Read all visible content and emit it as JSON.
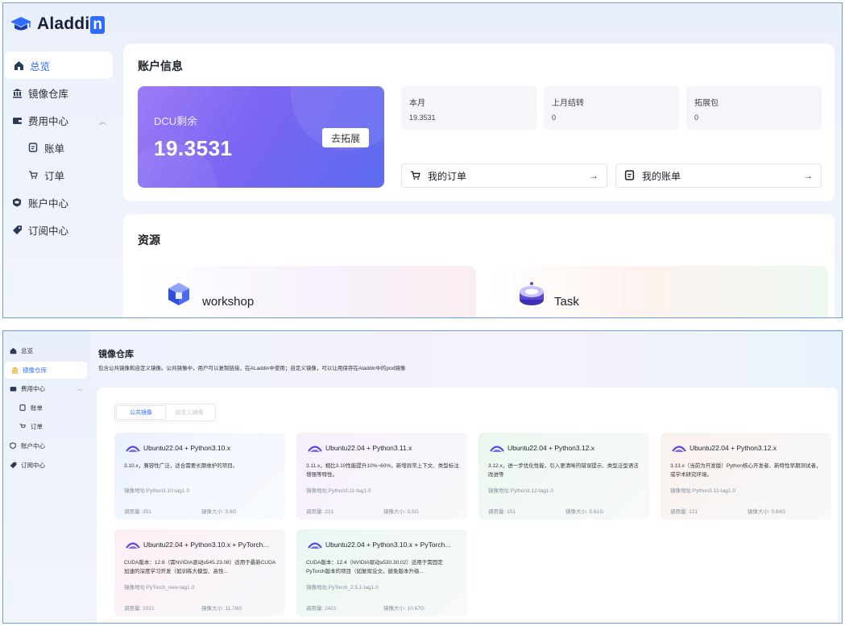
{
  "panel1": {
    "logo": {
      "text": "Aladdi",
      "mark": "n"
    },
    "sidebar": [
      {
        "label": "总览",
        "icon": "home-icon"
      },
      {
        "label": "镜像仓库",
        "icon": "repo-icon"
      },
      {
        "label": "费用中心",
        "icon": "wallet-icon"
      },
      {
        "label": "账单",
        "icon": "bill-icon"
      },
      {
        "label": "订单",
        "icon": "cart-icon"
      },
      {
        "label": "账户中心",
        "icon": "account-icon"
      },
      {
        "label": "订阅中心",
        "icon": "tag-icon"
      }
    ],
    "account": {
      "title": "账户信息",
      "dcu_label": "DCU剩余",
      "dcu_value": "19.3531",
      "expand_button": "去拓展",
      "stats": [
        {
          "label": "本月",
          "value": "19.3531"
        },
        {
          "label": "上月结转",
          "value": "0"
        },
        {
          "label": "拓展包",
          "value": "0"
        }
      ],
      "orders_link": "我的订单",
      "bills_link": "我的账单",
      "arrow": "→"
    },
    "resources": {
      "title": "资源",
      "items": [
        {
          "name": "workshop"
        },
        {
          "name": "Task"
        }
      ]
    }
  },
  "panel2": {
    "sidebar": [
      {
        "label": "总览"
      },
      {
        "label": "镜像仓库"
      },
      {
        "label": "费用中心"
      },
      {
        "label": "账单"
      },
      {
        "label": "订单"
      },
      {
        "label": "账户中心"
      },
      {
        "label": "订阅中心"
      }
    ],
    "header": {
      "title": "镜像仓库",
      "desc": "包含公共镜像和自定义镜像。公共镜像中，用户可以复制链接，在ALaddin中使用；自定义镜像，可以让用保存在Aladdin中的pod镜像"
    },
    "tabs": [
      "公共镜像",
      "自定义镜像"
    ],
    "images": [
      {
        "title": "Ubuntu22.04 + Python3.10.x",
        "desc": "3.10.x，兼容性广泛，适合需要长期维护的项目。",
        "addr": "镜像地址:Python3.10-tag1.0",
        "usage": "调用量:  351",
        "size": "镜像大小:  5.6G"
      },
      {
        "title": "Ubuntu22.04 + Python3.11.x",
        "desc": "3.11.x，相比3.10性能提升10%~60%，新增异常上下文、类型标注增强等特性。",
        "addr": "镜像地址:Python3.11-tag1.0",
        "usage": "调用量:  221",
        "size": "镜像大小:  5.5G"
      },
      {
        "title": "Ubuntu22.04 + Python3.12.x",
        "desc": "3.12.x，进一步优化性能，引入更清晰的错误提示、类型泛型语法改进等",
        "addr": "镜像地址:Python3.12-tag1.0",
        "usage": "调用量:  151",
        "size": "镜像大小:  5.61G"
      },
      {
        "title": "Ubuntu22.04 + Python3.12.x",
        "desc": "3.13.x（当前为开发版）Python核心开发者、新特性早期测试者，或学术研究环境。",
        "addr": "镜像地址:Python3.12-tag1.0",
        "usage": "调用量:  121",
        "size": "镜像大小:  5.64G"
      },
      {
        "title": "Ubuntu22.04 + Python3.10.x + PyTorch...",
        "desc": "CUDA版本：12.6（需NVIDIA驱动≥545.23.08）适用于最新CUDA加速的深度学习开发（如训练大模型、高性...",
        "addr": "镜像地址:PyTorch_new-tag1.0",
        "usage": "调用量:  1021",
        "size": "镜像大小:  11.78G"
      },
      {
        "title": "Ubuntu22.04 + Python3.10.x + PyTorch...",
        "desc": "CUDA版本：12.4（NVIDIA驱动≥530.30.02）适用于需固定PyTorch版本的项目（如复现论文，避免版本升级...",
        "addr": "镜像地址:PyTorch_2.5.1-tag1.0",
        "usage": "调用量:  2421",
        "size": "镜像大小:  10.67G"
      }
    ]
  },
  "colors": {
    "accent": "#2f6bff",
    "border": "#6c9fd6"
  }
}
